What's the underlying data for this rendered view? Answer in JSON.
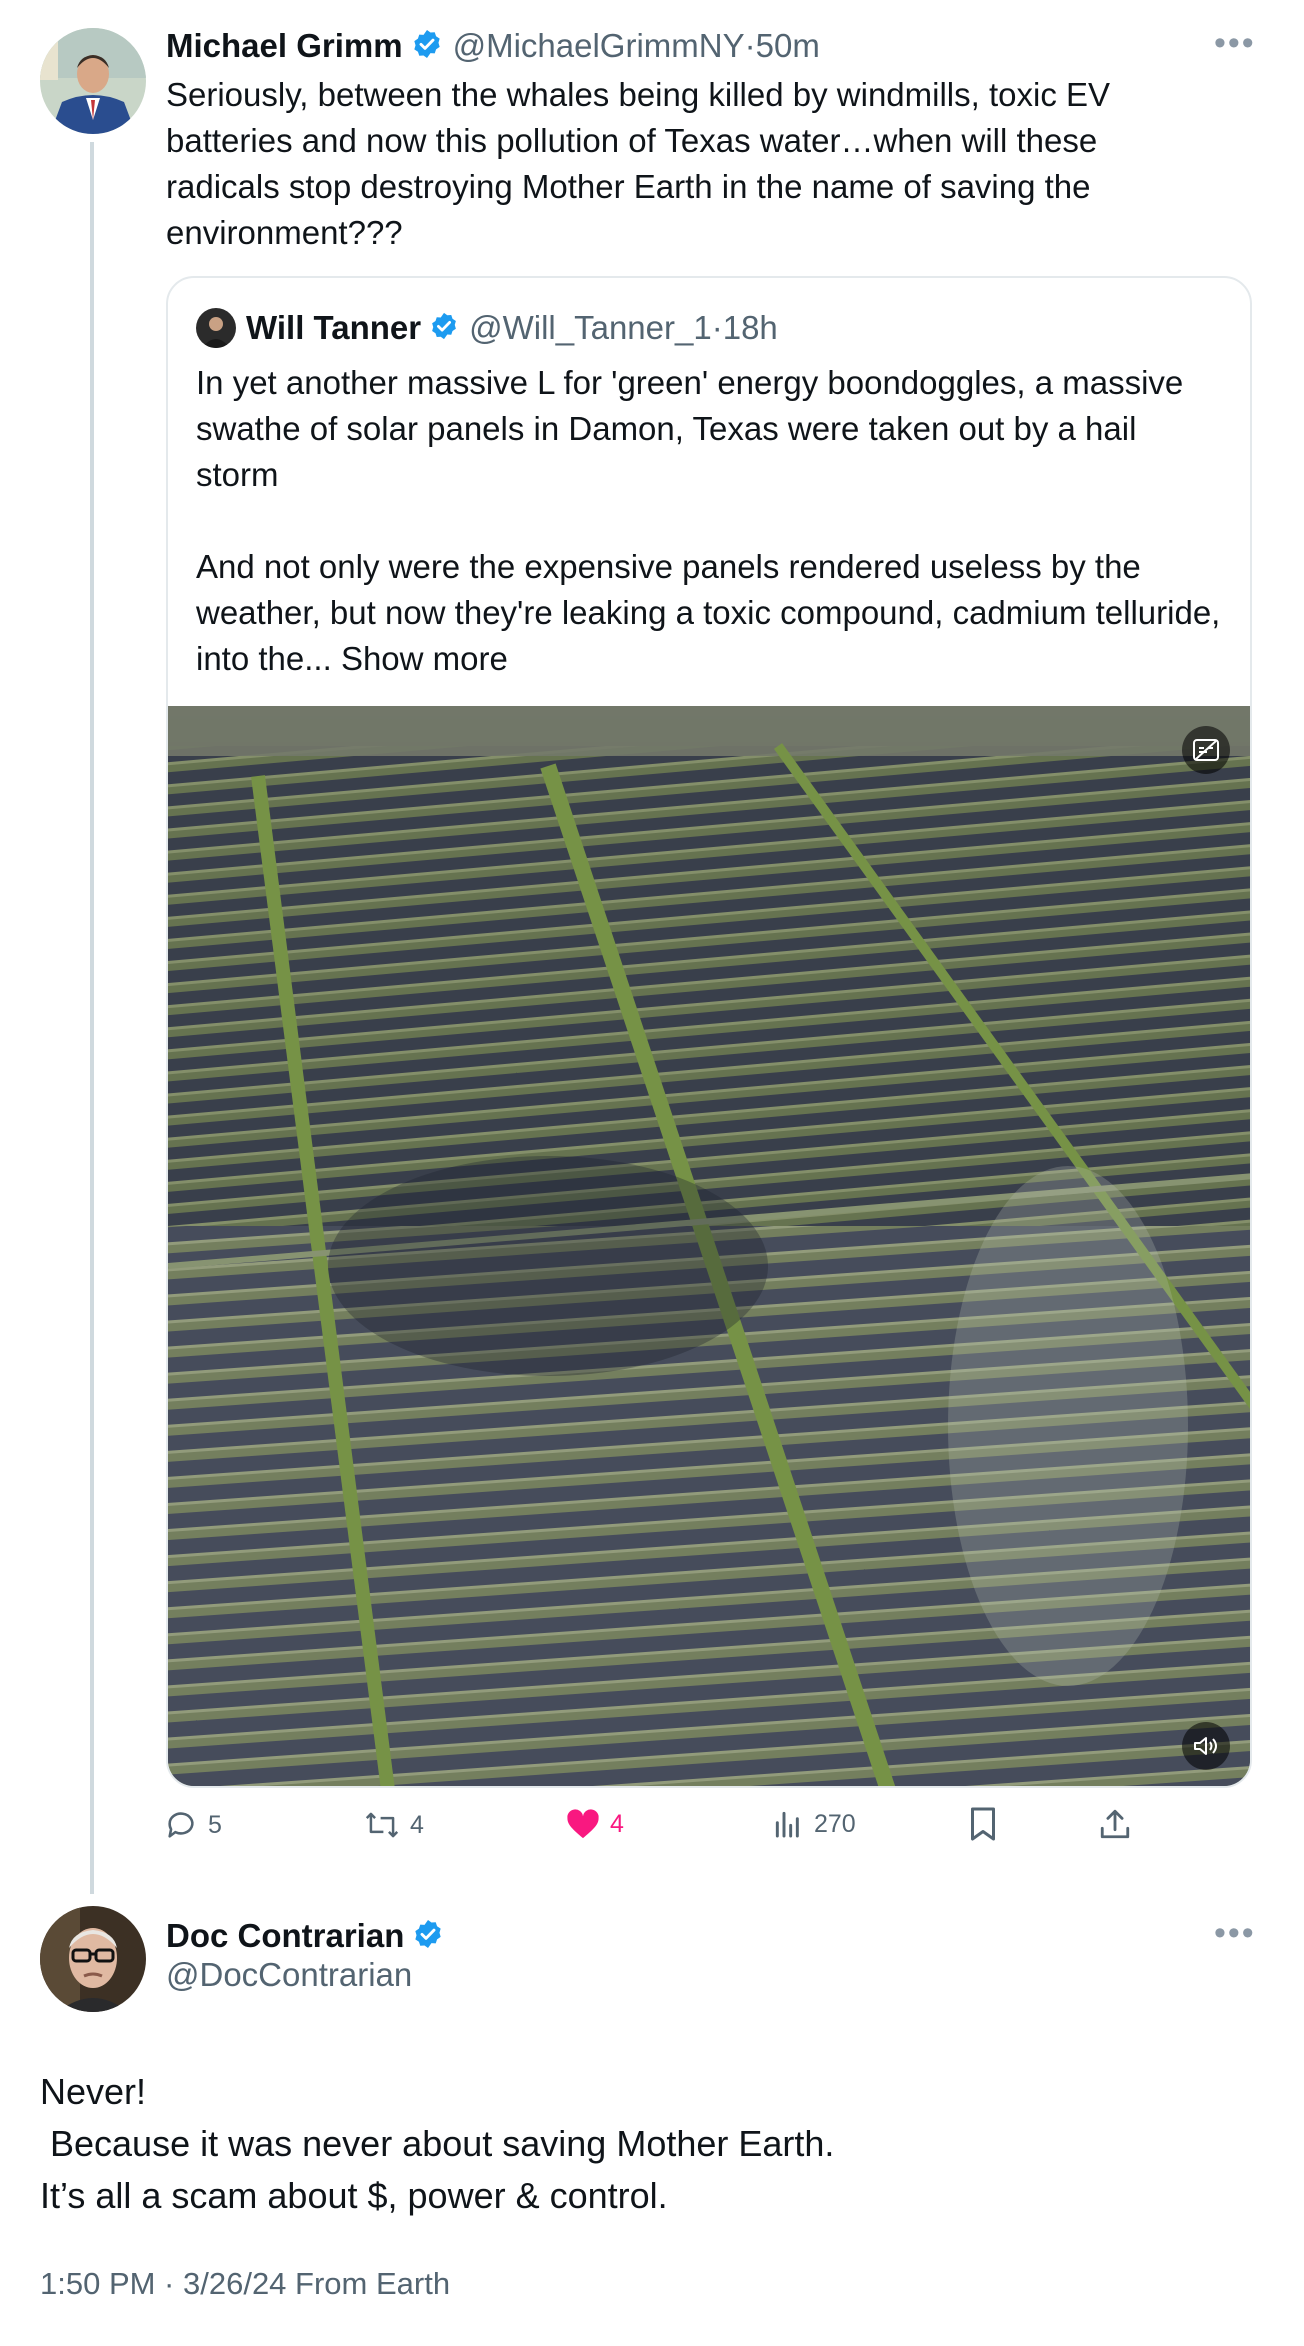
{
  "main_tweet": {
    "author_name": "Michael Grimm",
    "handle": "@MichaelGrimmNY",
    "separator": " · ",
    "time": "50m",
    "more_icon": "ellipsis-icon",
    "text": "Seriously, between the whales being killed by windmills, toxic EV batteries and now this pollution of Texas water…when will these radicals stop destroying Mother Earth in the name of saving the environment???"
  },
  "quoted_tweet": {
    "author_name": "Will Tanner",
    "handle": "@Will_Tanner_1",
    "separator": " · ",
    "time": "18h",
    "paragraph_1": "In yet another massive L for 'green' energy boondoggles, a massive swathe of solar panels in Damon, Texas were taken out by a hail storm",
    "paragraph_2": "And not only were the expensive panels rendered useless by the weather, but now they're leaking a toxic compound, cadmium telluride, into the...",
    "show_more": "Show more",
    "media_icons": [
      "captions-icon",
      "volume-icon"
    ]
  },
  "actions": {
    "replies": "5",
    "reposts": "4",
    "likes": "4",
    "views": "270",
    "like_color": "#f91880"
  },
  "reply_tweet": {
    "author_name": "Doc Contrarian",
    "handle": "@DocContrarian",
    "text": "Never!\n Because it was never about saving Mother Earth.\nIt’s all a scam about $, power & control.",
    "timestamp": "1:50 PM · 3/26/24 From Earth"
  },
  "colors": {
    "verified": "#1d9bf0",
    "secondary_text": "#536471",
    "thread_line": "#cfd9de"
  }
}
